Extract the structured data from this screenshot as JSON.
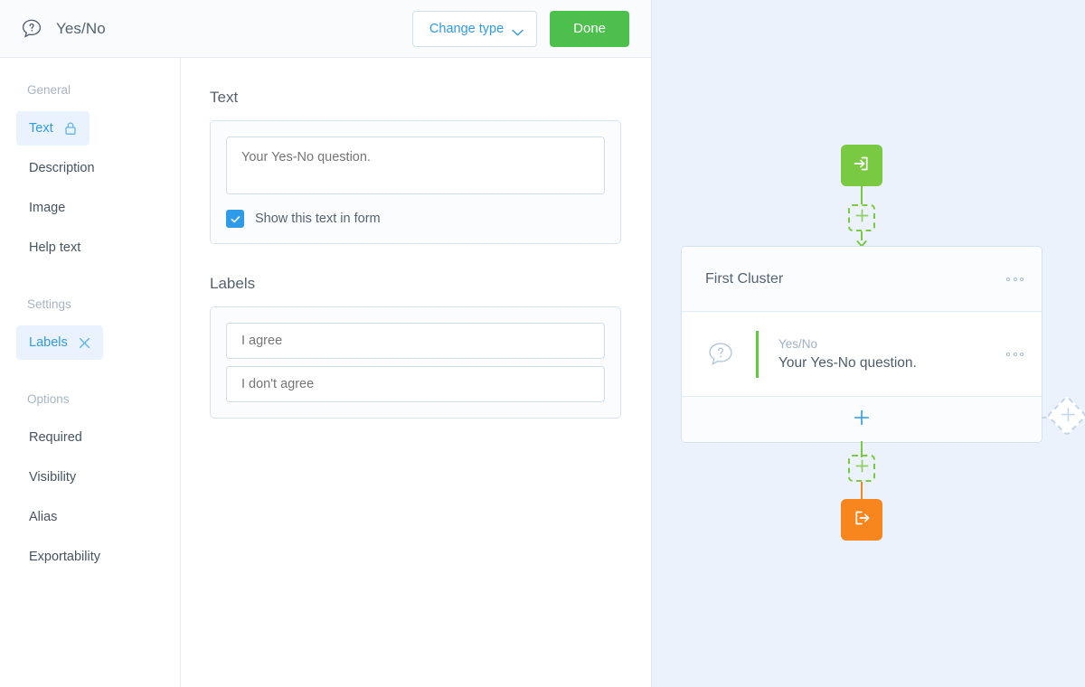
{
  "header": {
    "icon": "question-bubble-icon",
    "title": "Yes/No",
    "change_type_label": "Change type",
    "change_type_icon": "chevron-down-icon",
    "done_label": "Done"
  },
  "sidebar": {
    "groups": [
      {
        "label": "General",
        "items": [
          {
            "label": "Text",
            "icon": "lock-icon",
            "active": true
          },
          {
            "label": "Description",
            "icon": null,
            "active": false
          },
          {
            "label": "Image",
            "icon": null,
            "active": false
          },
          {
            "label": "Help text",
            "icon": null,
            "active": false
          }
        ]
      },
      {
        "label": "Settings",
        "items": [
          {
            "label": "Labels",
            "icon": "close-icon",
            "active": true
          }
        ]
      },
      {
        "label": "Options",
        "items": [
          {
            "label": "Required",
            "icon": null,
            "active": false
          },
          {
            "label": "Visibility",
            "icon": null,
            "active": false
          },
          {
            "label": "Alias",
            "icon": null,
            "active": false
          },
          {
            "label": "Exportability",
            "icon": null,
            "active": false
          }
        ]
      }
    ]
  },
  "main": {
    "text_section": {
      "title": "Text",
      "question_value": "Your Yes-No question.",
      "question_placeholder": "Your Yes-No question.",
      "checkbox_label": "Show this text in form",
      "checkbox_checked": true
    },
    "labels_section": {
      "title": "Labels",
      "fields": [
        {
          "value": "I agree",
          "placeholder": "I agree"
        },
        {
          "value": "I don't agree",
          "placeholder": "I don't agree"
        }
      ]
    }
  },
  "flow": {
    "start_node_icon": "enter-arrow-icon",
    "end_node_icon": "exit-arrow-icon",
    "add_node_icon": "plus-icon",
    "cluster": {
      "title": "First Cluster",
      "menu_icon": "ellipsis-icon",
      "question": {
        "icon": "question-bubble-icon",
        "type": "Yes/No",
        "label": "Your Yes-No question.",
        "menu_icon": "ellipsis-icon"
      },
      "add_question_icon": "plus-icon"
    },
    "side_add_icon": "plus-icon"
  },
  "colors": {
    "accent_blue": "#2f9ae8",
    "done_green": "#4cbf4c",
    "flow_green": "#7ac943",
    "flow_orange": "#f7861e",
    "question_bar_green": "#5ecb3a",
    "flow_bg": "#ebf2fb"
  }
}
